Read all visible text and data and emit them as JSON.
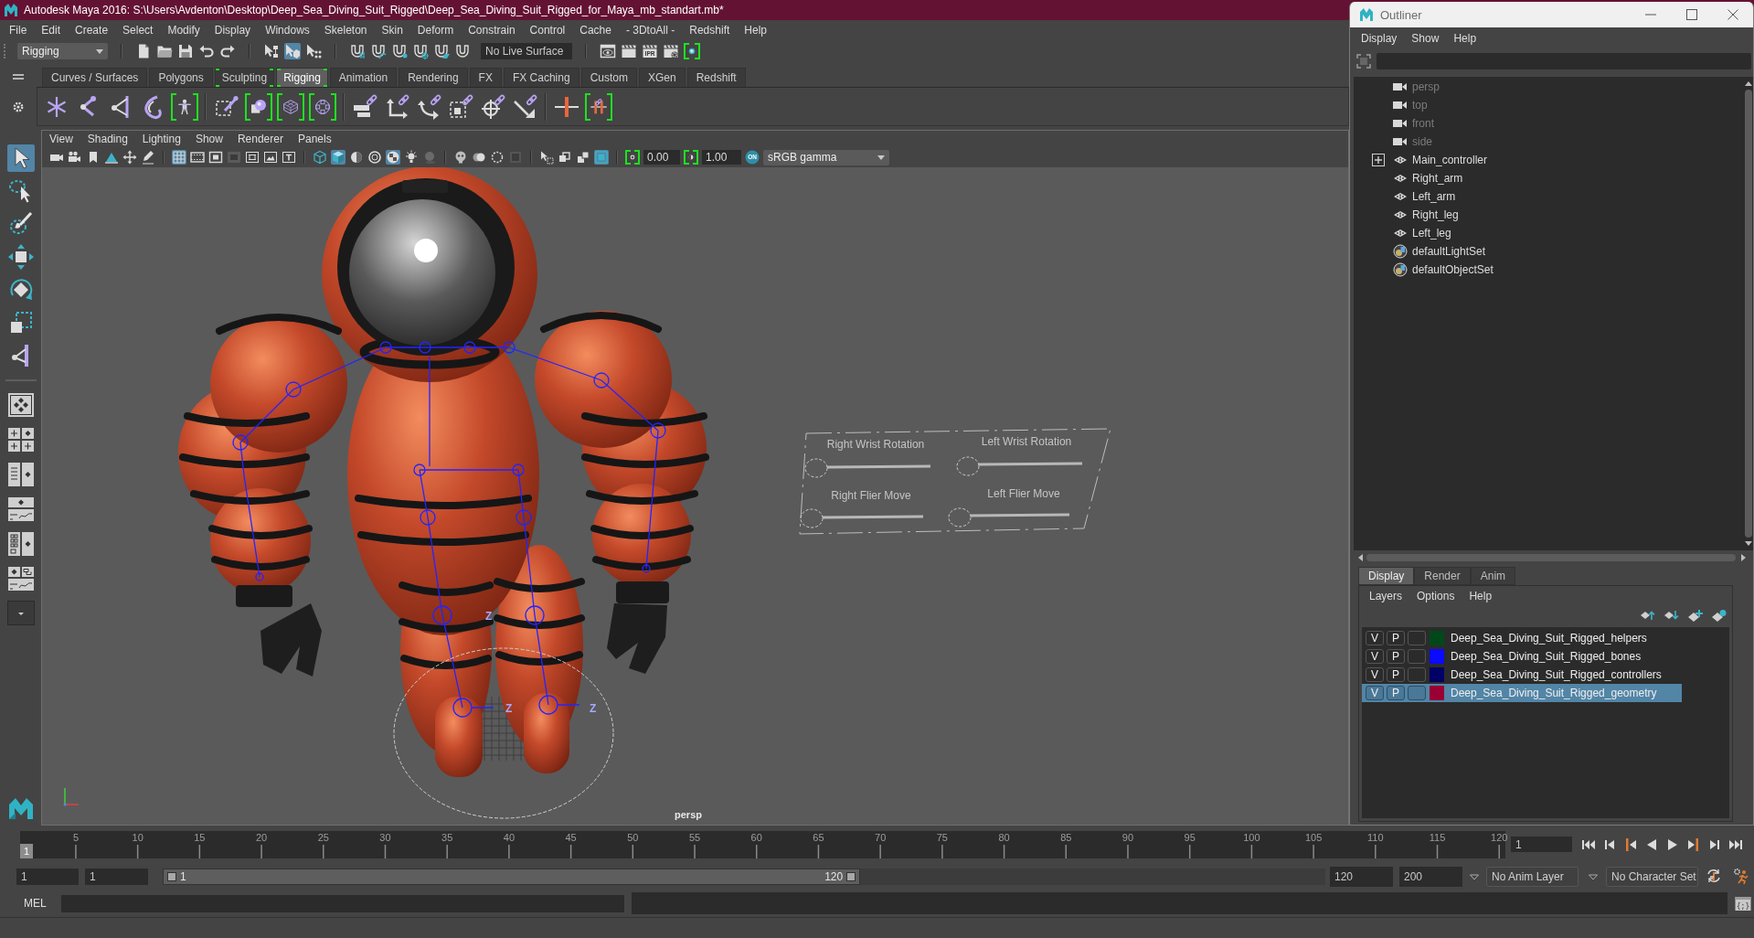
{
  "title_bar": {
    "title": "Autodesk Maya 2016: S:\\Users\\Avdenton\\Desktop\\Deep_Sea_Diving_Suit_Rigged\\Deep_Sea_Diving_Suit_Rigged_for_Maya_mb_standart.mb*"
  },
  "menu_bar": [
    "File",
    "Edit",
    "Create",
    "Select",
    "Modify",
    "Display",
    "Windows",
    "Skeleton",
    "Skin",
    "Deform",
    "Constrain",
    "Control",
    "Cache",
    "- 3DtoAll -",
    "Redshift",
    "Help"
  ],
  "status_line": {
    "menu_set": "Rigging",
    "select_mode_buttons": [
      {
        "selected": false
      },
      {
        "selected": true
      },
      {
        "selected": false
      }
    ],
    "live_surface": "No Live Surface",
    "render_buttons": [
      {
        "bracketed": false
      },
      {
        "bracketed": false
      },
      {
        "bracketed": false
      },
      {
        "bracketed": false
      },
      {
        "bracketed": true
      }
    ],
    "ipr_label": "IPR"
  },
  "shelf": {
    "tabs": [
      {
        "label": "Curves / Surfaces",
        "selected": false,
        "bracketed": false
      },
      {
        "label": "Polygons",
        "selected": false,
        "bracketed": false
      },
      {
        "label": "Sculpting",
        "selected": false,
        "bracketed": true
      },
      {
        "label": "Rigging",
        "selected": true,
        "bracketed": true
      },
      {
        "label": "Animation",
        "selected": false,
        "bracketed": false
      },
      {
        "label": "Rendering",
        "selected": false,
        "bracketed": false
      },
      {
        "label": "FX",
        "selected": false,
        "bracketed": false
      },
      {
        "label": "FX Caching",
        "selected": false,
        "bracketed": false
      },
      {
        "label": "Custom",
        "selected": false,
        "bracketed": false
      },
      {
        "label": "XGen",
        "selected": false,
        "bracketed": false
      },
      {
        "label": "Redshift",
        "selected": false,
        "bracketed": false
      }
    ],
    "buttons": [
      {
        "bracketed": false
      },
      {
        "bracketed": false
      },
      {
        "bracketed": false
      },
      {
        "bracketed": false
      },
      {
        "bracketed": true
      },
      {
        "bracketed": false
      },
      {
        "bracketed": true
      },
      {
        "bracketed": true
      },
      {
        "bracketed": true
      },
      {
        "bracketed": false
      },
      {
        "bracketed": false
      },
      {
        "bracketed": false
      },
      {
        "bracketed": false
      },
      {
        "bracketed": false
      },
      {
        "bracketed": false
      },
      {
        "bracketed": false
      },
      {
        "bracketed": true
      }
    ]
  },
  "toolbox": {
    "tools": [
      {
        "selected": true
      },
      {
        "selected": false
      },
      {
        "selected": false
      },
      {
        "selected": false
      },
      {
        "selected": false
      },
      {
        "selected": false
      },
      {
        "selected": false
      }
    ]
  },
  "viewport": {
    "menu": [
      "View",
      "Shading",
      "Lighting",
      "Show",
      "Renderer",
      "Panels"
    ],
    "toolbar_buttons": [
      {
        "on": false
      },
      {
        "on": false
      },
      {
        "on": false
      },
      {
        "on": false
      },
      {
        "on": false
      },
      {
        "on": false
      },
      {
        "on": true
      },
      {
        "on": false
      },
      {
        "on": false
      },
      {
        "on": false
      },
      {
        "on": false
      },
      {
        "on": false
      },
      {
        "on": false
      },
      {
        "on": false
      },
      {
        "on": true
      },
      {
        "on": false
      },
      {
        "on": false
      },
      {
        "on": true
      },
      {
        "on": false
      },
      {
        "on": false
      },
      {
        "on": false
      },
      {
        "on": false
      },
      {
        "on": false
      },
      {
        "on": false
      },
      {
        "on": false
      },
      {
        "on": false
      },
      {
        "on": false
      },
      {
        "on": true
      }
    ],
    "exposure_button": {
      "bracketed": true
    },
    "exposure": "0.00",
    "gamma_button": {
      "bracketed": true
    },
    "gamma": "1.00",
    "color_management": "ON",
    "color_space": "sRGB gamma",
    "control_panel": {
      "labels": [
        "Right Wrist Rotation",
        "Left Wrist Rotation",
        "Right Flier Move",
        "Left Flier Move"
      ]
    },
    "joint_axis_labels": [
      "Z",
      "Z",
      "Z"
    ],
    "camera_label": "persp"
  },
  "timeline": {
    "frame_numbers": [
      "5",
      "10",
      "15",
      "20",
      "25",
      "30",
      "35",
      "40",
      "45",
      "50",
      "55",
      "60",
      "65",
      "70",
      "75",
      "80",
      "85",
      "90",
      "95",
      "100",
      "105",
      "110",
      "115",
      "120"
    ],
    "current_frame_marker": "1",
    "current_frame": "1"
  },
  "range_slider": {
    "start_frame": "1",
    "playback_start": "1",
    "level": 0.6,
    "range_start": "1",
    "range_end": "120",
    "playback_end": "120",
    "end_frame": "200",
    "anim_layer": "No Anim Layer",
    "character_set": "No Character Set"
  },
  "command_line": {
    "language": "MEL",
    "script_editor_label": "{;}"
  },
  "outliner": {
    "title": "Outliner",
    "menu": [
      "Display",
      "Show",
      "Help"
    ],
    "items": [
      {
        "label": "persp",
        "kind": "camera",
        "hidden": true,
        "expandable": false
      },
      {
        "label": "top",
        "kind": "camera",
        "hidden": true,
        "expandable": false
      },
      {
        "label": "front",
        "kind": "camera",
        "hidden": true,
        "expandable": false
      },
      {
        "label": "side",
        "kind": "camera",
        "hidden": true,
        "expandable": false
      },
      {
        "label": "Main_controller",
        "kind": "transform",
        "hidden": false,
        "expandable": true
      },
      {
        "label": "Right_arm",
        "kind": "transform",
        "hidden": false,
        "expandable": false
      },
      {
        "label": "Left_arm",
        "kind": "transform",
        "hidden": false,
        "expandable": false
      },
      {
        "label": "Right_leg",
        "kind": "transform",
        "hidden": false,
        "expandable": false
      },
      {
        "label": "Left_leg",
        "kind": "transform",
        "hidden": false,
        "expandable": false
      },
      {
        "label": "defaultLightSet",
        "kind": "set",
        "hidden": false,
        "expandable": false
      },
      {
        "label": "defaultObjectSet",
        "kind": "set",
        "hidden": false,
        "expandable": false
      }
    ]
  },
  "layer_editor": {
    "tabs": [
      {
        "label": "Display",
        "selected": true
      },
      {
        "label": "Render",
        "selected": false
      },
      {
        "label": "Anim",
        "selected": false
      }
    ],
    "menu": [
      "Layers",
      "Options",
      "Help"
    ],
    "layers": [
      {
        "visibility": "V",
        "playback": "P",
        "name": "Deep_Sea_Diving_Suit_Rigged_helpers",
        "color": "#00481a",
        "selected": false
      },
      {
        "visibility": "V",
        "playback": "P",
        "name": "Deep_Sea_Diving_Suit_Rigged_bones",
        "color": "#0a0aff",
        "selected": false
      },
      {
        "visibility": "V",
        "playback": "P",
        "name": "Deep_Sea_Diving_Suit_Rigged_controllers",
        "color": "#000066",
        "selected": false
      },
      {
        "visibility": "V",
        "playback": "P",
        "name": "Deep_Sea_Diving_Suit_Rigged_geometry",
        "color": "#990033",
        "selected": true
      }
    ]
  }
}
